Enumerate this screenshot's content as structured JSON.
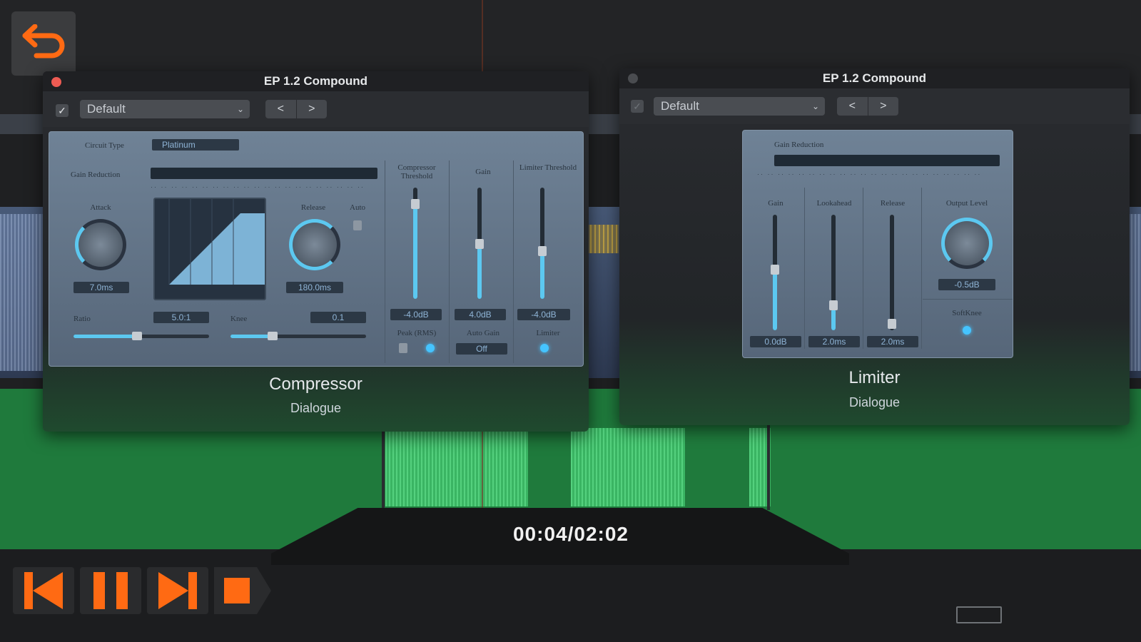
{
  "compressor": {
    "title": "EP 1.2 Compound",
    "preset": "Default",
    "nav_prev": "<",
    "nav_next": ">",
    "circuit_type_label": "Circuit Type",
    "circuit_type_value": "Platinum",
    "gain_reduction_label": "Gain Reduction",
    "attack_label": "Attack",
    "attack_value": "7.0ms",
    "release_label": "Release",
    "release_value": "180.0ms",
    "auto_label": "Auto",
    "ratio_label": "Ratio",
    "ratio_value": "5.0:1",
    "knee_label": "Knee",
    "knee_value": "0.1",
    "compressor_threshold_label": "Compressor Threshold",
    "compressor_threshold_value": "-4.0dB",
    "gain_label": "Gain",
    "gain_value": "4.0dB",
    "limiter_threshold_label": "Limiter Threshold",
    "limiter_threshold_value": "-4.0dB",
    "peak_rms_label": "Peak (RMS)",
    "auto_gain_label": "Auto Gain",
    "auto_gain_value": "Off",
    "limiter_toggle_label": "Limiter",
    "plugin_name": "Compressor",
    "track_name": "Dialogue"
  },
  "limiter": {
    "title": "EP 1.2 Compound",
    "preset": "Default",
    "nav_prev": "<",
    "nav_next": ">",
    "gain_reduction_label": "Gain Reduction",
    "gain_label": "Gain",
    "gain_value": "0.0dB",
    "lookahead_label": "Lookahead",
    "lookahead_value": "2.0ms",
    "release_label": "Release",
    "release_value": "2.0ms",
    "output_level_label": "Output Level",
    "output_level_value": "-0.5dB",
    "softknee_label": "SoftKnee",
    "plugin_name": "Limiter",
    "track_name": "Dialogue"
  },
  "player": {
    "time": "00:04/02:02"
  },
  "icons": [
    "back-arrow-icon",
    "skip-back-icon",
    "pause-icon",
    "skip-forward-icon",
    "stop-icon"
  ],
  "colors": {
    "accent": "#ff6a13",
    "meter": "#5cc8f0"
  }
}
